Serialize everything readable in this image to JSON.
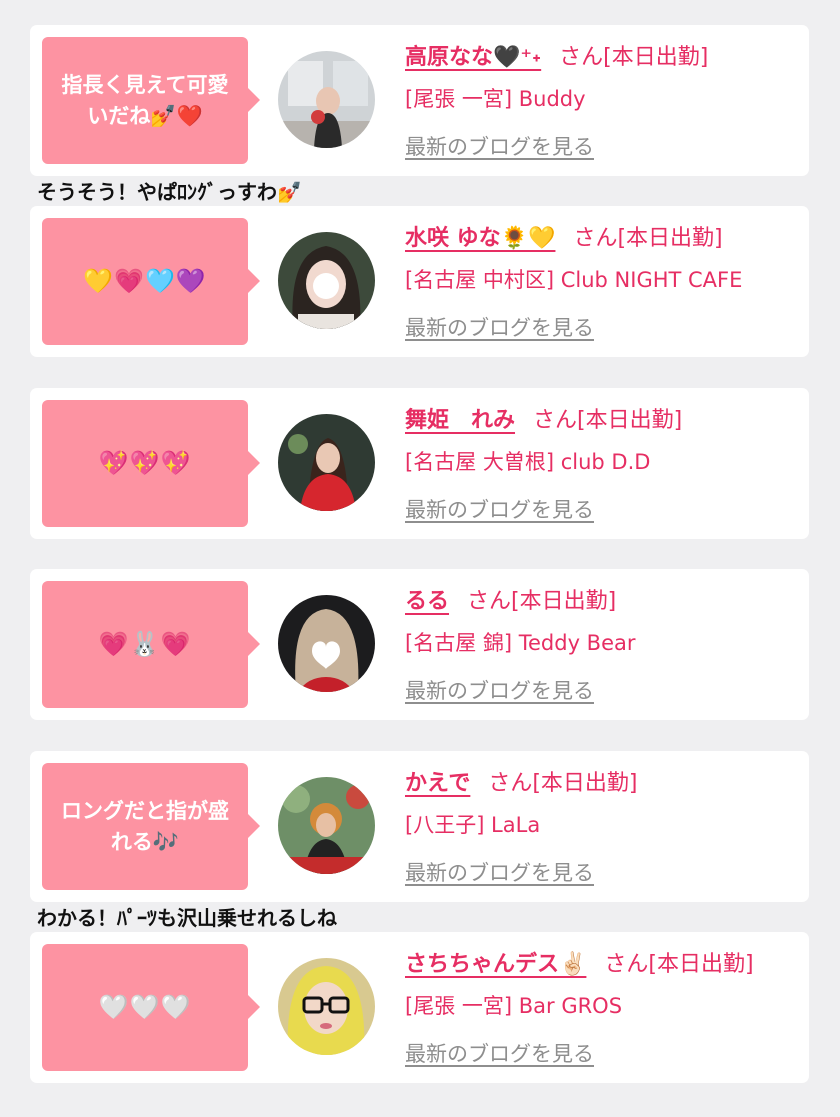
{
  "cards": [
    {
      "bubble": "指長く見えて可愛いだね💅❤️",
      "name": "高原なな🖤⁺˖",
      "honorific": "さん[本日出勤]",
      "shop": "[尾張 一宮] Buddy",
      "blog_link": "最新のブログを見る"
    },
    {
      "bubble": "💛💗🩵💜",
      "name": "水咲 ゆな🌻💛",
      "honorific": "さん[本日出勤]",
      "shop": "[名古屋 中村区] Club NIGHT CAFE",
      "blog_link": "最新のブログを見る"
    },
    {
      "bubble": "💖💖💖",
      "name": "舞姫　れみ",
      "honorific": "さん[本日出勤]",
      "shop": "[名古屋 大曽根] club D.D",
      "blog_link": "最新のブログを見る"
    },
    {
      "bubble": "💗🐰💗",
      "name": "るる",
      "honorific": "さん[本日出勤]",
      "shop": "[名古屋 錦] Teddy Bear",
      "blog_link": "最新のブログを見る"
    },
    {
      "bubble": "ロングだと指が盛れる🎶",
      "name": "かえで",
      "honorific": "さん[本日出勤]",
      "shop": "[八王子] LaLa",
      "blog_link": "最新のブログを見る"
    },
    {
      "bubble": "🤍🤍🤍",
      "name": "さちちゃんデス✌🏻",
      "honorific": "さん[本日出勤]",
      "shop": "[尾張 一宮] Bar GROS",
      "blog_link": "最新のブログを見る"
    }
  ],
  "comments": [
    "そうそう！やぱﾛﾝｸﾞっすわ💅",
    "わかる！ﾊﾟｰﾂも沢山乗せれるしね"
  ],
  "colors": {
    "background": "#efeff1",
    "bubble": "#fd93a2",
    "accent": "#e62e63",
    "link_gray": "#8e8e8e"
  }
}
